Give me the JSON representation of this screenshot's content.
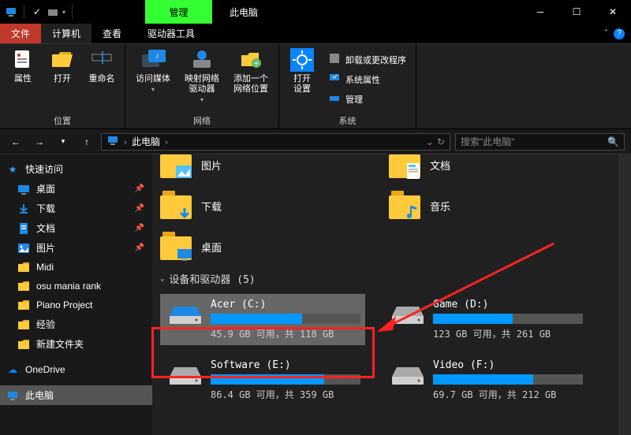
{
  "titlebar": {
    "context_tab": "管理",
    "title": "此电脑"
  },
  "ribbon_tabs": {
    "file": "文件",
    "computer": "计算机",
    "view": "查看",
    "drive_tools": "驱动器工具"
  },
  "ribbon": {
    "group_location": "位置",
    "group_network": "网络",
    "group_system": "系统",
    "btn_properties": "属性",
    "btn_open": "打开",
    "btn_rename": "重命名",
    "btn_access_media": "访问媒体",
    "btn_map_network": "映射网络\n驱动器",
    "btn_add_net_loc": "添加一个\n网络位置",
    "btn_open_settings": "打开\n设置",
    "lnk_uninstall": "卸载或更改程序",
    "lnk_sys_props": "系统属性",
    "lnk_manage": "管理"
  },
  "addressbar": {
    "path": "此电脑",
    "search_placeholder": "搜索\"此电脑\""
  },
  "sidebar": {
    "quick_access": "快速访问",
    "items": [
      {
        "label": "桌面",
        "pinned": true,
        "icon": "desktop"
      },
      {
        "label": "下载",
        "pinned": true,
        "icon": "download"
      },
      {
        "label": "文档",
        "pinned": true,
        "icon": "document"
      },
      {
        "label": "图片",
        "pinned": true,
        "icon": "picture"
      },
      {
        "label": "Midi",
        "pinned": false,
        "icon": "folder"
      },
      {
        "label": "osu mania rank",
        "pinned": false,
        "icon": "folder"
      },
      {
        "label": "Piano Project",
        "pinned": false,
        "icon": "folder"
      },
      {
        "label": "经验",
        "pinned": false,
        "icon": "folder"
      },
      {
        "label": "新建文件夹",
        "pinned": false,
        "icon": "folder"
      }
    ],
    "onedrive": "OneDrive",
    "this_pc": "此电脑"
  },
  "main": {
    "folders": [
      {
        "name": "图片",
        "type": "picture"
      },
      {
        "name": "文档",
        "type": "document"
      },
      {
        "name": "下载",
        "type": "download"
      },
      {
        "name": "音乐",
        "type": "music"
      },
      {
        "name": "桌面",
        "type": "desktop"
      }
    ],
    "section_devices": "设备和驱动器 (5)",
    "drives": [
      {
        "name": "Acer (C:)",
        "text": "45.9 GB 可用，共 118 GB",
        "fill": 61,
        "selected": true
      },
      {
        "name": "Game (D:)",
        "text": "123 GB 可用，共 261 GB",
        "fill": 53,
        "selected": false
      },
      {
        "name": "Software (E:)",
        "text": "86.4 GB 可用，共 359 GB",
        "fill": 76,
        "selected": false
      },
      {
        "name": "Video (F:)",
        "text": "69.7 GB 可用，共 212 GB",
        "fill": 67,
        "selected": false
      }
    ]
  }
}
